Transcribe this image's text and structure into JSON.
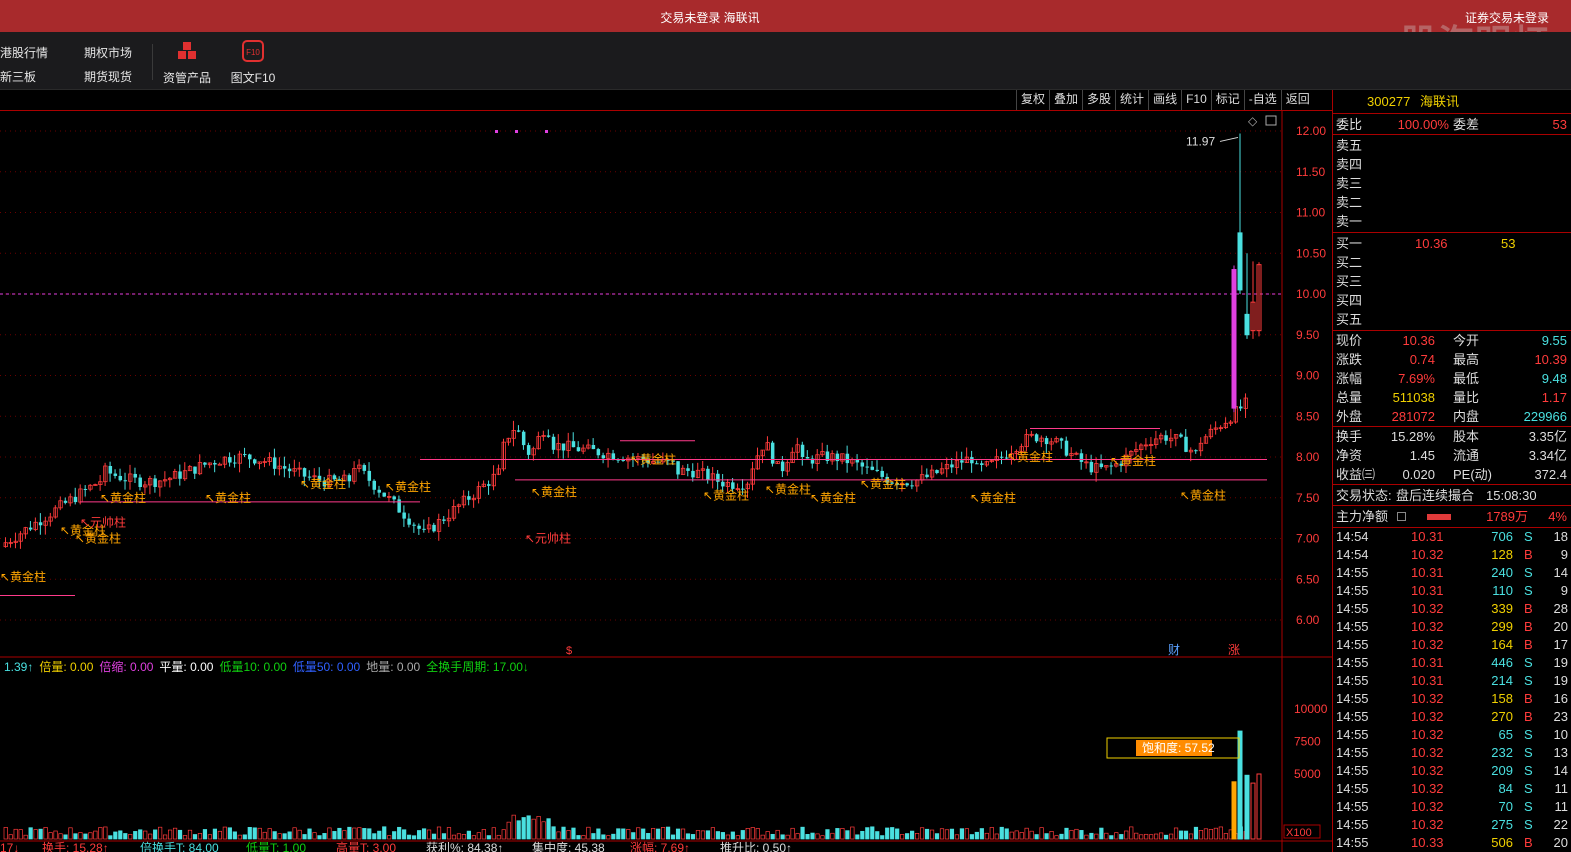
{
  "window": {
    "title": "交易未登录  海联讯",
    "right_status": "证券交易未登录",
    "watermark": "股海明灯"
  },
  "nav": {
    "hk_quotes": "港股行情",
    "options_market": "期权市场",
    "neeq": "新三板",
    "futures_spot": "期货现货",
    "asset_products": "资管产品",
    "f10_text": "图文F10",
    "f10_badge": "F10"
  },
  "chart_tools": [
    "复权",
    "叠加",
    "多股",
    "统计",
    "画线",
    "F10",
    "标记",
    "-自选",
    "返回"
  ],
  "stock": {
    "code": "300277",
    "name": "海联讯"
  },
  "order_book": {
    "wei_bi_label": "委比",
    "wei_bi": "100.00%",
    "wei_cha_label": "委差",
    "wei_cha": "53",
    "asks": [
      "卖五",
      "卖四",
      "卖三",
      "卖二",
      "卖一"
    ],
    "bids": [
      {
        "label": "买一",
        "price": "10.36",
        "vol": "53"
      },
      {
        "label": "买二",
        "price": "",
        "vol": ""
      },
      {
        "label": "买三",
        "price": "",
        "vol": ""
      },
      {
        "label": "买四",
        "price": "",
        "vol": ""
      },
      {
        "label": "买五",
        "price": "",
        "vol": ""
      }
    ]
  },
  "quote": [
    {
      "l1": "现价",
      "v1": "10.36",
      "l2": "今开",
      "v2": "9.55"
    },
    {
      "l1": "涨跌",
      "v1": "0.74",
      "l2": "最高",
      "v2": "10.39"
    },
    {
      "l1": "涨幅",
      "v1": "7.69%",
      "l2": "最低",
      "v2": "9.48"
    },
    {
      "l1": "总量",
      "v1": "511038",
      "l2": "量比",
      "v2": "1.17"
    },
    {
      "l1": "外盘",
      "v1": "281072",
      "l2": "内盘",
      "v2": "229966"
    }
  ],
  "stats": [
    {
      "l1": "换手",
      "v1": "15.28%",
      "l2": "股本",
      "v2": "3.35亿"
    },
    {
      "l1": "净资",
      "v1": "1.45",
      "l2": "流通",
      "v2": "3.34亿"
    },
    {
      "l1": "收益㈢",
      "v1": "0.020",
      "l2": "PE(动)",
      "v2": "372.4"
    }
  ],
  "trade_state": {
    "label": "交易状态:",
    "value": "盘后连续撮合",
    "time": "15:08:30"
  },
  "main_force": {
    "label": "主力净额",
    "amount": "1789万",
    "pct": "4%"
  },
  "ticks": [
    {
      "t": "14:54",
      "p": "10.31",
      "v": "706",
      "s": "S",
      "n": "18"
    },
    {
      "t": "14:54",
      "p": "10.32",
      "v": "128",
      "s": "B",
      "n": "9"
    },
    {
      "t": "14:55",
      "p": "10.31",
      "v": "240",
      "s": "S",
      "n": "14"
    },
    {
      "t": "14:55",
      "p": "10.31",
      "v": "110",
      "s": "S",
      "n": "9"
    },
    {
      "t": "14:55",
      "p": "10.32",
      "v": "339",
      "s": "B",
      "n": "28"
    },
    {
      "t": "14:55",
      "p": "10.32",
      "v": "299",
      "s": "B",
      "n": "20"
    },
    {
      "t": "14:55",
      "p": "10.32",
      "v": "164",
      "s": "B",
      "n": "17"
    },
    {
      "t": "14:55",
      "p": "10.31",
      "v": "446",
      "s": "S",
      "n": "19"
    },
    {
      "t": "14:55",
      "p": "10.31",
      "v": "214",
      "s": "S",
      "n": "19"
    },
    {
      "t": "14:55",
      "p": "10.32",
      "v": "158",
      "s": "B",
      "n": "16"
    },
    {
      "t": "14:55",
      "p": "10.32",
      "v": "270",
      "s": "B",
      "n": "23"
    },
    {
      "t": "14:55",
      "p": "10.32",
      "v": "65",
      "s": "S",
      "n": "10"
    },
    {
      "t": "14:55",
      "p": "10.32",
      "v": "232",
      "s": "S",
      "n": "13"
    },
    {
      "t": "14:55",
      "p": "10.32",
      "v": "209",
      "s": "S",
      "n": "14"
    },
    {
      "t": "14:55",
      "p": "10.32",
      "v": "84",
      "s": "S",
      "n": "11"
    },
    {
      "t": "14:55",
      "p": "10.32",
      "v": "70",
      "s": "S",
      "n": "11"
    },
    {
      "t": "14:55",
      "p": "10.32",
      "v": "275",
      "s": "S",
      "n": "22"
    },
    {
      "t": "14:55",
      "p": "10.33",
      "v": "506",
      "s": "B",
      "n": "20"
    }
  ],
  "price_axis": [
    "12.00",
    "11.50",
    "11.00",
    "10.50",
    "10.00",
    "9.50",
    "9.00",
    "8.50",
    "8.00",
    "7.50",
    "7.00",
    "6.50",
    "6.00"
  ],
  "vol_axis": [
    "10000",
    "7500",
    "5000"
  ],
  "vol_unit": "X100",
  "high_label": "11.97",
  "annotations": {
    "gold": "黄金柱",
    "yuanshuai": "元帅柱"
  },
  "markers": {
    "cai": "财",
    "zhang": "涨",
    "dollar": "$"
  },
  "saturation": "饱和度: 57.52",
  "vol_legend": [
    {
      "text": "1.39↑",
      "color": "#4ae0e0"
    },
    {
      "text": "倍量: 0.00",
      "color": "#f0d000"
    },
    {
      "text": "倍缩: 0.00",
      "color": "#e040e0"
    },
    {
      "text": "平量: 0.00",
      "color": "#ffffff"
    },
    {
      "text": "低量10: 0.00",
      "color": "#10d010"
    },
    {
      "text": "低量50: 0.00",
      "color": "#3060ff"
    },
    {
      "text": "地量: 0.00",
      "color": "#aaaaaa"
    },
    {
      "text": "全换手周期: 17.00↓",
      "color": "#10d010"
    }
  ],
  "bottom_legend": [
    {
      "text": "17↓",
      "color": "#ff3b3b"
    },
    {
      "text": "换手: 15.28↑",
      "color": "#ff3b3b"
    },
    {
      "text": "倍换手T: 84.00",
      "color": "#4ae0e0"
    },
    {
      "text": "低量T: 1.00",
      "color": "#10d010"
    },
    {
      "text": "高量T: 3.00",
      "color": "#ff3b3b"
    },
    {
      "text": "获利%: 84.38↑",
      "color": "#ddd"
    },
    {
      "text": "集中度: 45.38",
      "color": "#ddd"
    },
    {
      "text": "涨幅: 7.69↑",
      "color": "#ff3b3b"
    },
    {
      "text": "推升比: 0.50↑",
      "color": "#ddd"
    }
  ]
}
